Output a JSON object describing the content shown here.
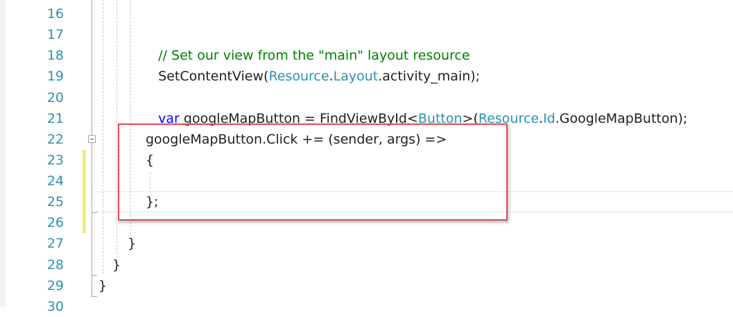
{
  "editor": {
    "line_numbers": [
      "16",
      "17",
      "18",
      "19",
      "20",
      "21",
      "22",
      "23",
      "24",
      "25",
      "26",
      "27",
      "28",
      "29",
      "30"
    ],
    "lines": {
      "l15_tail": {
        "plain": "          |                  |"
      },
      "l17": {
        "comment": "// Set our view from the \"main\" layout resource"
      },
      "l18": {
        "a": "SetContentView(",
        "b": "Resource",
        "c": ".",
        "d": "Layout",
        "e": ".activity_main);"
      },
      "l20": {
        "kw": "var",
        "a": " googleMapButton = FindViewById<",
        "type1": "Button",
        "b": ">(",
        "type2": "Resource",
        "c": ".",
        "type3": "Id",
        "d": ".GoogleMapButton);"
      },
      "l22": {
        "text": "googleMapButton.Click += (sender, args) =>"
      },
      "l23": {
        "text": "{"
      },
      "l25": {
        "text": "};"
      },
      "l27": {
        "text": "}"
      },
      "l28": {
        "text": "}"
      },
      "l29": {
        "text": "}"
      }
    },
    "colors": {
      "line_number": "#2b91af",
      "keyword": "#0000ff",
      "type": "#2b91af",
      "comment": "#008000",
      "change_bar": "#eeea78",
      "highlight_box": "#e5484d"
    }
  }
}
